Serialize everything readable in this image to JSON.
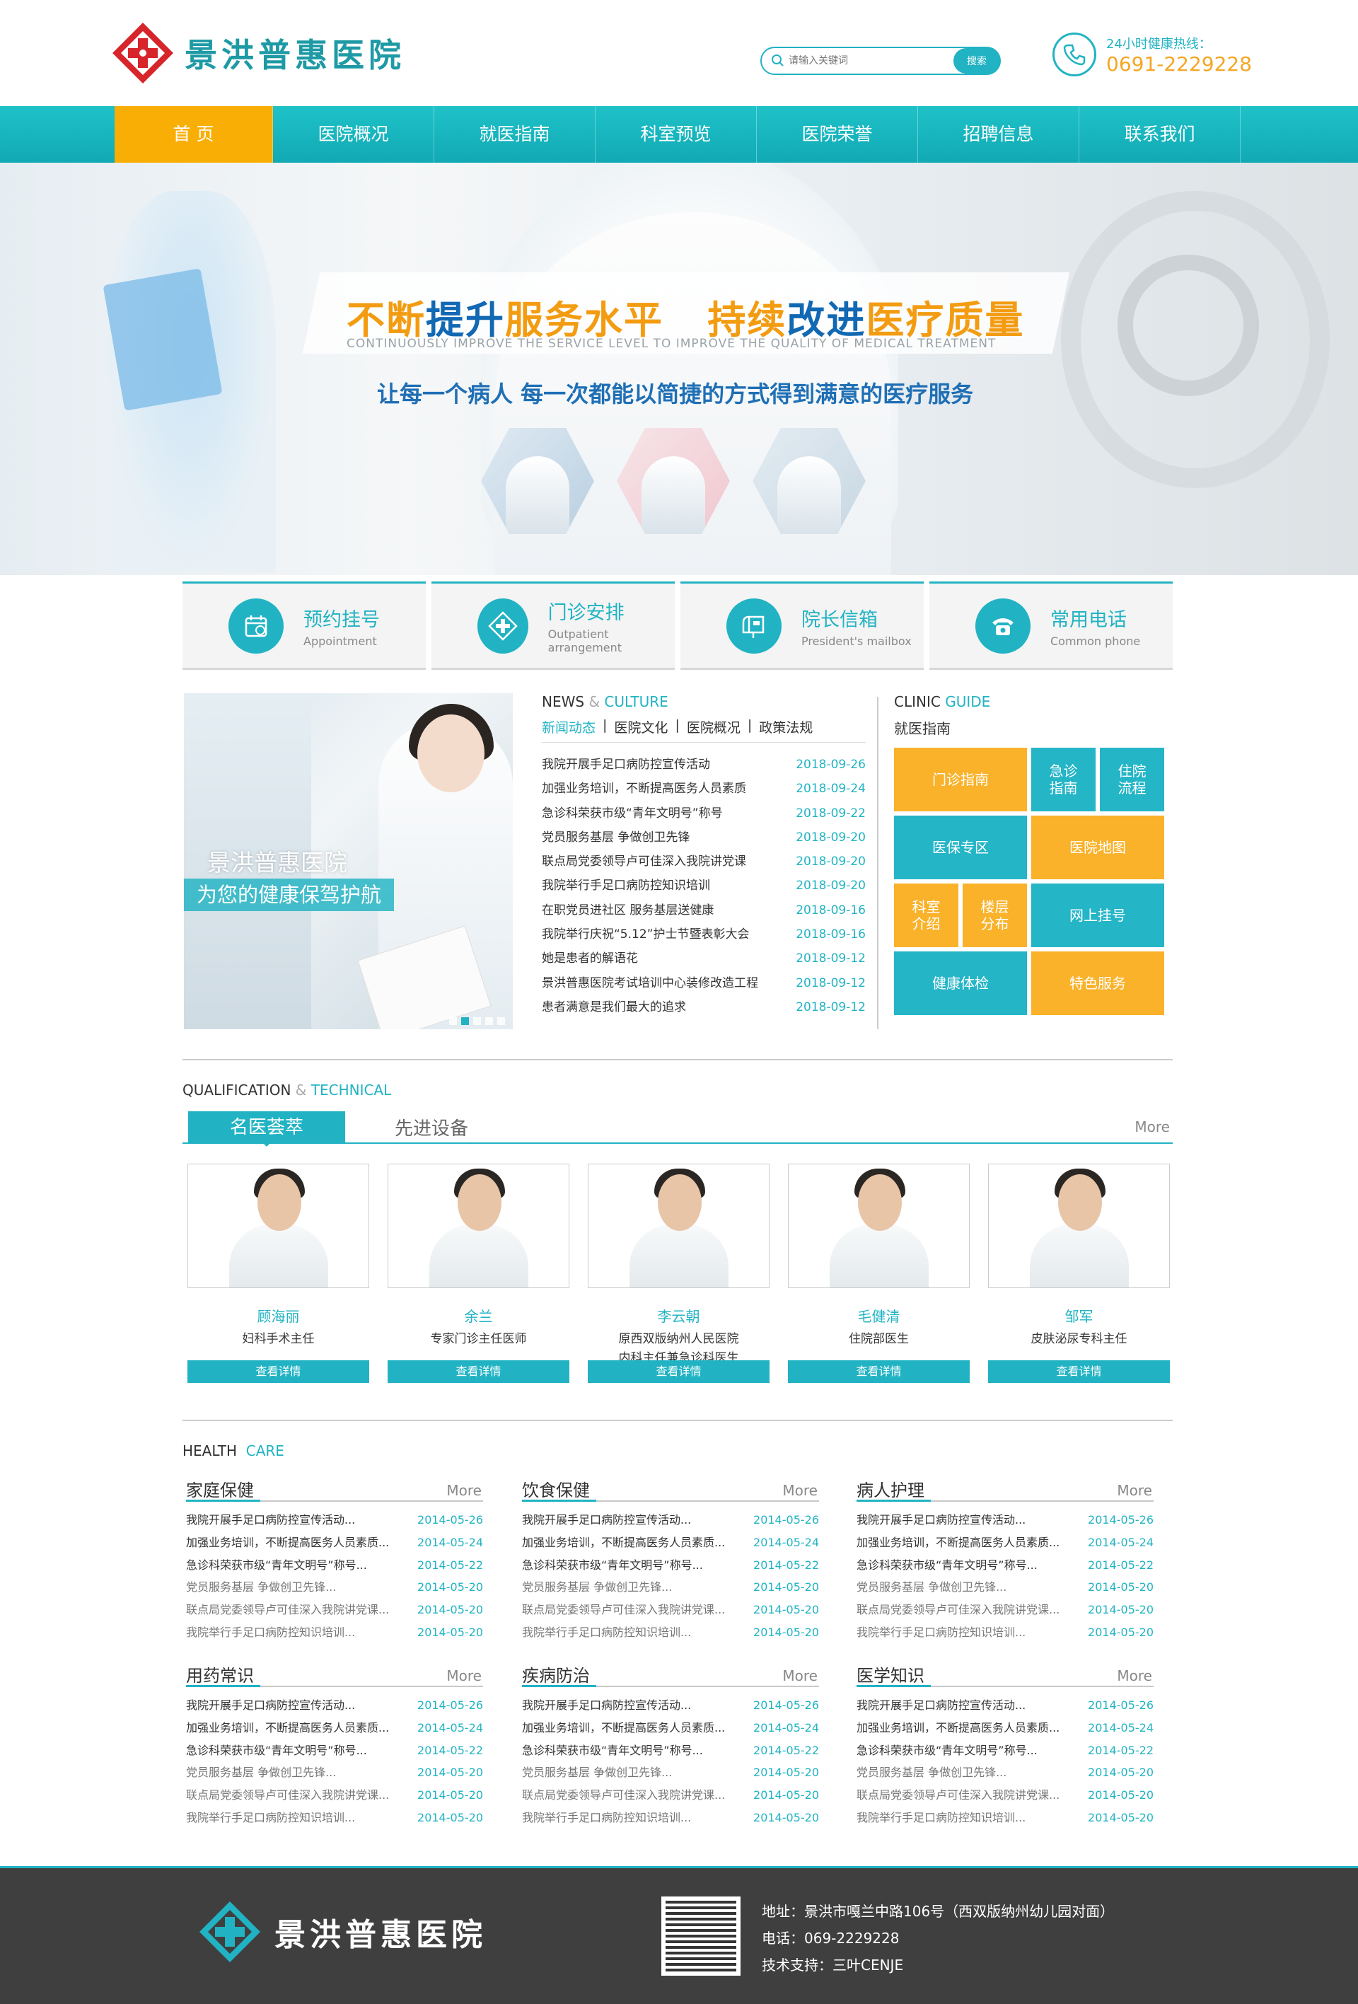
{
  "header": {
    "logo_text": "景洪普惠医院",
    "search_placeholder": "请输入关键词",
    "search_button": "搜索",
    "hotline_label": "24小时健康热线：",
    "hotline_number": "0691-2229228"
  },
  "nav": {
    "items": [
      "首 页",
      "医院概况",
      "就医指南",
      "科室预览",
      "医院荣誉",
      "招聘信息",
      "联系我们"
    ],
    "active_index": 0
  },
  "banner": {
    "headline_parts": [
      {
        "text": "不断",
        "color": "orange"
      },
      {
        "text": "提升",
        "color": "blue"
      },
      {
        "text": "服务水平   ",
        "color": "orange"
      },
      {
        "text": "持续",
        "color": "orange"
      },
      {
        "text": "改进",
        "color": "blue"
      },
      {
        "text": "医疗质量",
        "color": "orange"
      }
    ],
    "subtitle_en": "CONTINUOUSLY IMPROVE THE SERVICE LEVEL TO IMPROVE THE QUALITY OF MEDICAL TREATMENT",
    "tagline": "让每一个病人 每一次都能以简捷的方式得到满意的医疗服务"
  },
  "quick_links": [
    {
      "cn": "预约挂号",
      "en": "Appointment",
      "icon": "calendar-icon"
    },
    {
      "cn": "门诊安排",
      "en": "Outpatient arrangement",
      "icon": "medical-cross-icon"
    },
    {
      "cn": "院长信箱",
      "en": "President's mailbox",
      "icon": "mailbox-icon"
    },
    {
      "cn": "常用电话",
      "en": "Common phone",
      "icon": "phone-icon"
    }
  ],
  "promo": {
    "title": "景洪普惠医院",
    "subtitle": "为您的健康保驾护航"
  },
  "news": {
    "heading_a": "NEWS",
    "heading_amp": "&",
    "heading_b": "CULTURE",
    "tabs": [
      "新闻动态",
      "医院文化",
      "医院概况",
      "政策法规"
    ],
    "items": [
      {
        "title": "我院开展手足口病防控宣传活动",
        "date": "2018-09-26"
      },
      {
        "title": "加强业务培训，不断提高医务人员素质",
        "date": "2018-09-24"
      },
      {
        "title": "急诊科荣获市级“青年文明号”称号",
        "date": "2018-09-22"
      },
      {
        "title": "党员服务基层 争做创卫先锋",
        "date": "2018-09-20"
      },
      {
        "title": "联点局党委领导卢可佳深入我院讲党课",
        "date": "2018-09-20"
      },
      {
        "title": "我院举行手足口病防控知识培训",
        "date": "2018-09-20"
      },
      {
        "title": "在职党员进社区 服务基层送健康",
        "date": "2018-09-16"
      },
      {
        "title": "我院举行庆祝“5.12”护士节暨表彰大会",
        "date": "2018-09-16"
      },
      {
        "title": "她是患者的解语花",
        "date": "2018-09-12"
      },
      {
        "title": "景洪普惠医院考试培训中心装修改造工程",
        "date": "2018-09-12"
      },
      {
        "title": "患者满意是我们最大的追求",
        "date": "2018-09-12"
      }
    ]
  },
  "guide": {
    "heading_a": "CLINIC",
    "heading_b": "GUIDE",
    "subtitle": "就医指南",
    "tiles": [
      "门诊指南",
      "急诊\n指南",
      "住院\n流程",
      "医保专区",
      "医院地图",
      "科室\n介绍",
      "楼层\n分布",
      "网上挂号",
      "健康体检",
      "特色服务"
    ]
  },
  "doctors": {
    "heading_a": "QUALIFICATION",
    "heading_amp": "&",
    "heading_b": "TECHNICAL",
    "tab_active": "名医荟萃",
    "tab_other": "先进设备",
    "more": "More",
    "detail_label": "查看详情",
    "items": [
      {
        "name": "顾海丽",
        "title": "妇科手术主任"
      },
      {
        "name": "余兰",
        "title": "专家门诊主任医师"
      },
      {
        "name": "李云朝",
        "title": "原西双版纳州人民医院\n内科主任兼急诊科医生"
      },
      {
        "name": "毛健清",
        "title": "住院部医生"
      },
      {
        "name": "邹军",
        "title": "皮肤泌尿专科主任"
      }
    ]
  },
  "health": {
    "heading_a": "HEALTH",
    "heading_b": "CARE",
    "more": "More",
    "columns": [
      {
        "title": "家庭保健"
      },
      {
        "title": "饮食保健"
      },
      {
        "title": "病人护理"
      },
      {
        "title": "用药常识"
      },
      {
        "title": "疾病防治"
      },
      {
        "title": "医学知识"
      }
    ],
    "items": [
      {
        "title": "我院开展手足口病防控宣传活动...",
        "date": "2014-05-26",
        "gray": false
      },
      {
        "title": "加强业务培训，不断提高医务人员素质...",
        "date": "2014-05-24",
        "gray": false
      },
      {
        "title": "急诊科荣获市级“青年文明号”称号...",
        "date": "2014-05-22",
        "gray": false
      },
      {
        "title": "党员服务基层 争做创卫先锋...",
        "date": "2014-05-20",
        "gray": true
      },
      {
        "title": "联点局党委领导卢可佳深入我院讲党课...",
        "date": "2014-05-20",
        "gray": true
      },
      {
        "title": "我院举行手足口病防控知识培训...",
        "date": "2014-05-20",
        "gray": true
      }
    ]
  },
  "footer": {
    "logo_text": "景洪普惠医院",
    "address": "地址：景洪市嘎兰中路106号（西双版纳州幼儿园对面）",
    "phone": "电话：069-2229228",
    "support": "技术支持：三叶CENJE"
  },
  "colors": {
    "accent": "#21b3c3",
    "orange": "#f9ae05",
    "tile_yellow": "#f9b22a",
    "footer_bg": "#3f3f3f"
  }
}
